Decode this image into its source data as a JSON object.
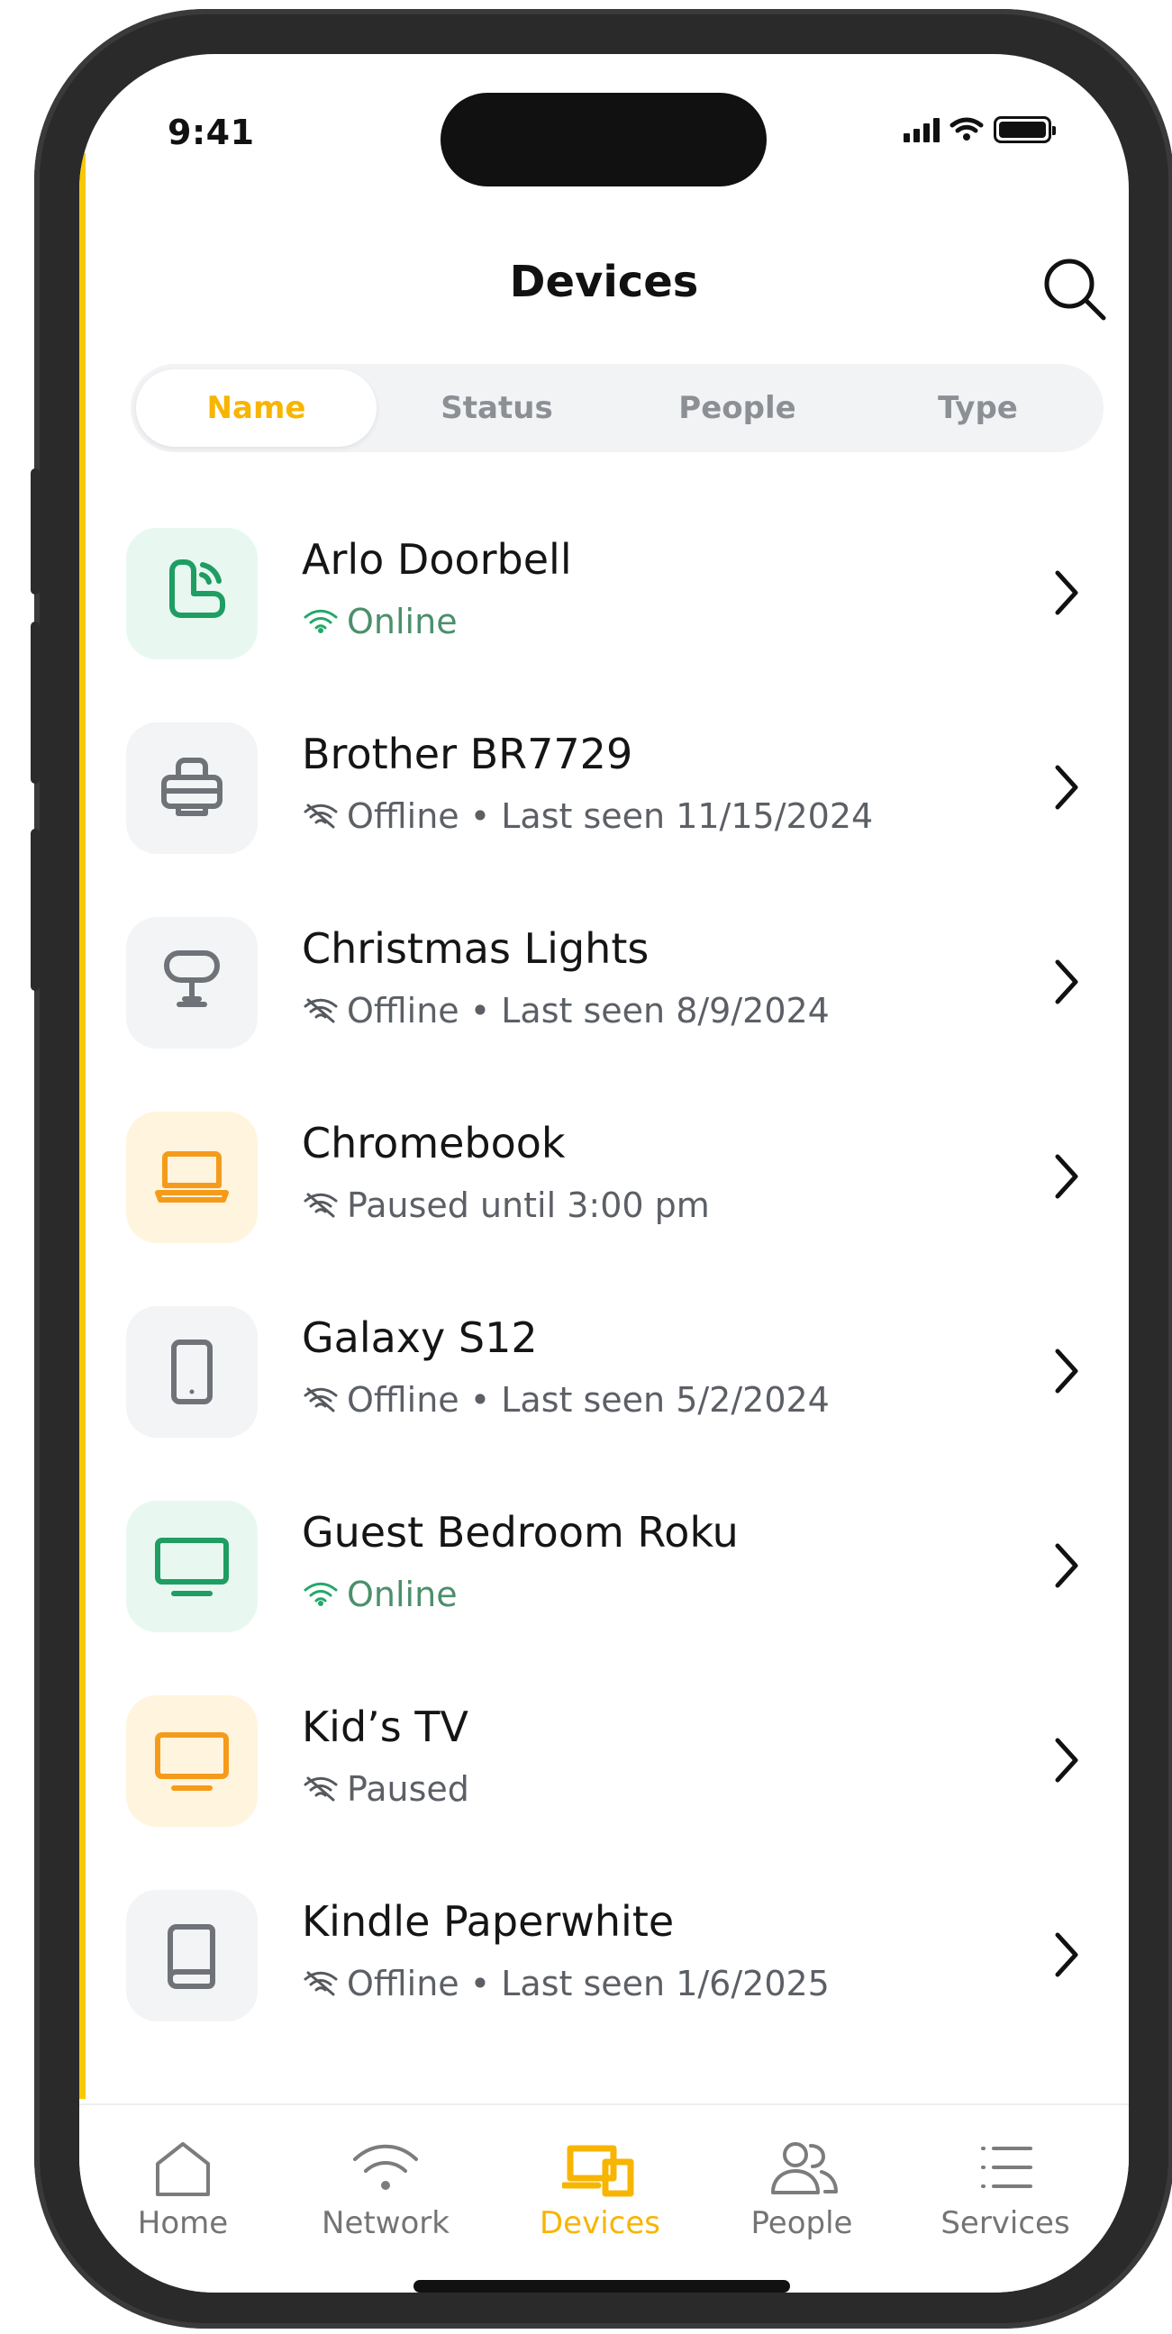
{
  "status_bar": {
    "time": "9:41"
  },
  "header": {
    "title": "Devices"
  },
  "segments": [
    "Name",
    "Status",
    "People",
    "Type"
  ],
  "active_segment": "Name",
  "devices": [
    {
      "name": "Arlo Doorbell",
      "status": "Online",
      "icon": "doorbell-icon",
      "tone": "green"
    },
    {
      "name": "Brother BR7729",
      "status": "Offline • Last seen 11/15/2024",
      "icon": "printer-icon",
      "tone": "gray"
    },
    {
      "name": "Christmas Lights",
      "status": "Offline • Last seen 8/9/2024",
      "icon": "lamp-icon",
      "tone": "gray"
    },
    {
      "name": "Chromebook",
      "status": "Paused until 3:00 pm",
      "icon": "laptop-icon",
      "tone": "orange"
    },
    {
      "name": "Galaxy S12",
      "status": "Offline • Last seen 5/2/2024",
      "icon": "phone-icon",
      "tone": "gray"
    },
    {
      "name": "Guest Bedroom Roku",
      "status": "Online",
      "icon": "tv-icon",
      "tone": "green"
    },
    {
      "name": "Kid’s TV",
      "status": "Paused",
      "icon": "tv-icon",
      "tone": "orange"
    },
    {
      "name": "Kindle Paperwhite",
      "status": "Offline • Last seen 1/6/2025",
      "icon": "ereader-icon",
      "tone": "gray"
    }
  ],
  "tabs": [
    {
      "label": "Home",
      "icon": "home-icon"
    },
    {
      "label": "Network",
      "icon": "wifi-icon"
    },
    {
      "label": "Devices",
      "icon": "devices-icon"
    },
    {
      "label": "People",
      "icon": "people-icon"
    },
    {
      "label": "Services",
      "icon": "list-icon"
    }
  ],
  "active_tab": "Devices",
  "colors": {
    "accent": "#f7b500",
    "green": "#1f9d62",
    "orange": "#f59b1b",
    "gray": "#6f7378"
  }
}
